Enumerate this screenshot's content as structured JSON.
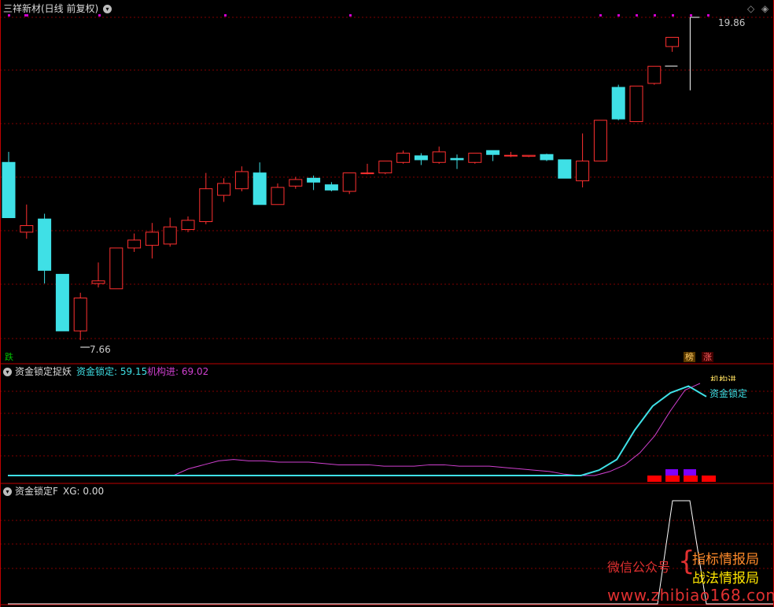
{
  "main": {
    "title": "三祥新材(日线 前复权)",
    "high_label": "19.86",
    "low_label": "7.66",
    "corner_left": "跌",
    "corner_right_1": "榜",
    "corner_right_2": "涨",
    "candles": [
      {
        "o": 14.35,
        "c": 12.25,
        "h": 14.75,
        "l": 12.25
      },
      {
        "o": 11.7,
        "c": 11.95,
        "h": 12.75,
        "l": 11.45
      },
      {
        "o": 12.2,
        "c": 10.25,
        "h": 12.4,
        "l": 9.75
      },
      {
        "o": 10.1,
        "c": 7.95,
        "h": 10.1,
        "l": 7.95
      },
      {
        "o": 7.95,
        "c": 9.2,
        "h": 9.4,
        "l": 7.6
      },
      {
        "o": 9.75,
        "c": 9.85,
        "h": 10.55,
        "l": 9.6
      },
      {
        "o": 9.55,
        "c": 11.1,
        "h": 11.1,
        "l": 9.55
      },
      {
        "o": 11.1,
        "c": 11.4,
        "h": 11.65,
        "l": 10.95
      },
      {
        "o": 11.2,
        "c": 11.7,
        "h": 12.05,
        "l": 10.7
      },
      {
        "o": 11.25,
        "c": 11.9,
        "h": 12.25,
        "l": 11.15
      },
      {
        "o": 11.8,
        "c": 12.15,
        "h": 12.3,
        "l": 11.7
      },
      {
        "o": 12.1,
        "c": 13.35,
        "h": 13.95,
        "l": 12.0
      },
      {
        "o": 13.1,
        "c": 13.55,
        "h": 13.75,
        "l": 12.85
      },
      {
        "o": 13.35,
        "c": 14.0,
        "h": 14.2,
        "l": 13.25
      },
      {
        "o": 13.95,
        "c": 12.75,
        "h": 14.35,
        "l": 12.75
      },
      {
        "o": 12.75,
        "c": 13.4,
        "h": 13.55,
        "l": 12.75
      },
      {
        "o": 13.45,
        "c": 13.7,
        "h": 13.8,
        "l": 13.35
      },
      {
        "o": 13.75,
        "c": 13.6,
        "h": 13.85,
        "l": 13.3
      },
      {
        "o": 13.5,
        "c": 13.3,
        "h": 13.6,
        "l": 13.25
      },
      {
        "o": 13.25,
        "c": 13.95,
        "h": 13.95,
        "l": 13.15
      },
      {
        "o": 13.95,
        "c": 13.95,
        "h": 14.3,
        "l": 13.9
      },
      {
        "o": 13.95,
        "c": 14.4,
        "h": 14.4,
        "l": 13.9
      },
      {
        "o": 14.35,
        "c": 14.7,
        "h": 14.8,
        "l": 14.3
      },
      {
        "o": 14.6,
        "c": 14.45,
        "h": 14.7,
        "l": 14.25
      },
      {
        "o": 14.35,
        "c": 14.75,
        "h": 14.95,
        "l": 14.3
      },
      {
        "o": 14.5,
        "c": 14.45,
        "h": 14.65,
        "l": 14.1
      },
      {
        "o": 14.35,
        "c": 14.7,
        "h": 14.7,
        "l": 14.3
      },
      {
        "o": 14.8,
        "c": 14.65,
        "h": 14.8,
        "l": 14.4
      },
      {
        "o": 14.6,
        "c": 14.62,
        "h": 14.75,
        "l": 14.55
      },
      {
        "o": 14.58,
        "c": 14.62,
        "h": 14.62,
        "l": 14.55
      },
      {
        "o": 14.65,
        "c": 14.45,
        "h": 14.68,
        "l": 14.4
      },
      {
        "o": 14.45,
        "c": 13.75,
        "h": 14.45,
        "l": 13.75
      },
      {
        "o": 13.65,
        "c": 14.4,
        "h": 15.45,
        "l": 13.4
      },
      {
        "o": 14.4,
        "c": 15.95,
        "h": 15.95,
        "l": 14.4
      },
      {
        "o": 17.2,
        "c": 16.0,
        "h": 17.3,
        "l": 15.95
      },
      {
        "o": 15.9,
        "c": 17.25,
        "h": 17.25,
        "l": 15.9
      },
      {
        "o": 17.35,
        "c": 18.0,
        "h": 18.0,
        "l": 17.3
      },
      {
        "o": 18.75,
        "c": 19.1,
        "h": 19.1,
        "l": 18.55
      }
    ],
    "last_open_tick_price": 19.3,
    "signal_candles": [
      0,
      5,
      19,
      33,
      34,
      35,
      36,
      37,
      38
    ]
  },
  "panel1": {
    "title": "资金锁定捉妖",
    "line1_label": "资金锁定: 59.15",
    "line2_label": "机构进: 69.02",
    "line1_tag": "资金锁定",
    "line2_tag": "机构进",
    "line1_color": "#3fe0e6",
    "line2_color": "#d040d0",
    "line1": [
      0,
      0,
      0,
      0,
      0,
      0,
      0,
      0,
      0,
      0,
      0,
      0,
      0,
      0,
      0,
      0,
      0,
      0,
      0,
      0,
      0,
      0,
      0,
      0,
      0,
      0,
      0,
      0,
      0,
      0,
      0,
      0,
      0,
      4,
      12,
      34,
      52,
      62,
      67,
      59.15
    ],
    "line2": [
      0,
      0,
      0,
      0,
      0,
      0,
      0,
      0,
      0,
      0,
      0,
      0,
      5,
      8,
      11,
      12,
      11,
      11,
      10,
      10,
      10,
      9,
      8,
      8,
      8,
      7,
      7,
      7,
      8,
      8,
      7,
      7,
      7,
      6,
      5,
      4,
      3,
      1,
      0,
      0,
      3,
      8,
      17,
      30,
      48,
      64,
      69.02
    ],
    "bars_red": [
      36,
      37,
      38,
      39
    ],
    "bars_purple": [
      37,
      38
    ]
  },
  "panel2": {
    "title": "资金锁定F",
    "label": "XG: 0.00",
    "xg": [
      0,
      0,
      0,
      0,
      0,
      0,
      0,
      0,
      0,
      0,
      0,
      0,
      0,
      0,
      0,
      0,
      0,
      0,
      0,
      0,
      0,
      0,
      0,
      0,
      0,
      0,
      0,
      0,
      0,
      0,
      0,
      0,
      0,
      0,
      0,
      0,
      1,
      1,
      0,
      0
    ]
  },
  "watermark": {
    "line_a": "微信公众号",
    "brace": "{",
    "line_b": "指标情报局",
    "line_c": "战法情报局",
    "url": "www.zhibiao168.com"
  },
  "colors": {
    "up": "#ff3030",
    "down": "#3fe0e6",
    "grid": "#800000",
    "magenta": "#d000d0",
    "red_bar": "#ff0000",
    "purple_bar": "#8000ff"
  }
}
